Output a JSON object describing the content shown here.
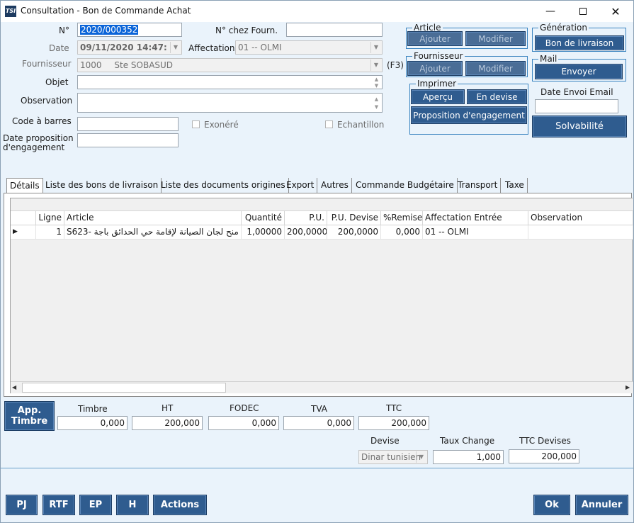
{
  "window": {
    "title": "Consultation - Bon de Commande Achat",
    "app_icon": "TSI"
  },
  "header": {
    "numero_label": "N°",
    "numero_value": "2020/000352",
    "chez_fourn_label": "N° chez Fourn.",
    "chez_fourn_value": "",
    "date_label": "Date",
    "date_value": "09/11/2020 14:47:",
    "affectation_label": "Affectation",
    "affectation_value": "01 -- OLMI",
    "fournisseur_label": "Fournisseur",
    "fournisseur_code": "1000",
    "fournisseur_name": "Ste SOBASUD",
    "f3_hint": "(F3)",
    "objet_label": "Objet",
    "objet_value": "",
    "observation_label": "Observation",
    "observation_value": "",
    "code_barres_label": "Code à barres",
    "code_barres_value": "",
    "exonere_label": "Exonéré",
    "echantillon_label": "Echantillon",
    "date_prop_label_1": "Date proposition",
    "date_prop_label_2": "d'engagement",
    "date_prop_value": ""
  },
  "groups": {
    "article": {
      "title": "Article",
      "ajouter": "Ajouter",
      "modifier": "Modifier"
    },
    "fournisseur": {
      "title": "Fournisseur",
      "ajouter": "Ajouter",
      "modifier": "Modifier"
    },
    "imprimer": {
      "title": "Imprimer",
      "apercu": "Aperçu",
      "en_devise": "En devise",
      "proposition": "Proposition d'engagement"
    },
    "generation": {
      "title": "Génération",
      "bon_livraison": "Bon de livraison"
    },
    "mail": {
      "title": "Mail",
      "envoyer": "Envoyer"
    },
    "date_envoi_label": "Date Envoi Email",
    "date_envoi_value": "",
    "solvabilite": "Solvabilité"
  },
  "tabs": [
    "Détails",
    "Liste des bons de livraison",
    "Liste des documents origines",
    "Export",
    "Autres",
    "Commande Budgétaire",
    "Transport",
    "Taxe"
  ],
  "grid": {
    "columns": [
      "Ligne",
      "Article",
      "Quantité",
      "P.U.",
      "P.U. Devise",
      "%Remise",
      "Affectation Entrée",
      "Observation"
    ],
    "rows": [
      {
        "ligne": "1",
        "article": "S623- منح لجان الصيانة لإقامة حي الحدائق باجة",
        "quantite": "1,00000",
        "pu": "200,0000",
        "pu_devise": "200,0000",
        "remise": "0,000",
        "affectation": "01 -- OLMI",
        "observation": ""
      }
    ]
  },
  "totals": {
    "app_timbre_1": "App.",
    "app_timbre_2": "Timbre",
    "timbre_label": "Timbre",
    "timbre_value": "0,000",
    "ht_label": "HT",
    "ht_value": "200,000",
    "fodec_label": "FODEC",
    "fodec_value": "0,000",
    "tva_label": "TVA",
    "tva_value": "0,000",
    "ttc_label": "TTC",
    "ttc_value": "200,000",
    "devise_label": "Devise",
    "devise_value": "Dinar tunisien",
    "taux_label": "Taux Change",
    "taux_value": "1,000",
    "ttc_devises_label": "TTC Devises",
    "ttc_devises_value": "200,000"
  },
  "footer": {
    "pj": "PJ",
    "rtf": "RTF",
    "ep": "EP",
    "h": "H",
    "actions": "Actions",
    "ok": "Ok",
    "annuler": "Annuler"
  }
}
